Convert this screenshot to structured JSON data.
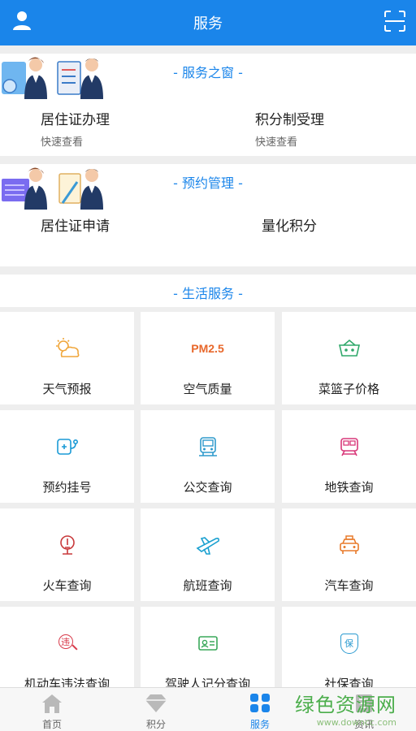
{
  "header": {
    "title": "服务"
  },
  "service_window": {
    "title": "- 服务之窗 -",
    "items": [
      {
        "name": "居住证办理",
        "sub": "快速查看"
      },
      {
        "name": "积分制受理",
        "sub": "快速查看"
      }
    ]
  },
  "appointment": {
    "title": "- 预约管理 -",
    "items": [
      {
        "name": "居住证申请"
      },
      {
        "name": "量化积分"
      }
    ]
  },
  "life": {
    "title": "- 生活服务 -",
    "items": [
      {
        "label": "天气预报",
        "icon": "weather-icon",
        "color": "#f0a63a"
      },
      {
        "label": "空气质量",
        "icon": "pm25-icon",
        "icon_text": "PM2.5",
        "color": "#e8672a"
      },
      {
        "label": "菜篮子价格",
        "icon": "basket-icon",
        "color": "#2fa86a"
      },
      {
        "label": "预约挂号",
        "icon": "stethoscope-icon",
        "color": "#1a9ad6"
      },
      {
        "label": "公交查询",
        "icon": "bus-icon",
        "color": "#2f9acc"
      },
      {
        "label": "地铁查询",
        "icon": "subway-icon",
        "color": "#d8397a"
      },
      {
        "label": "火车查询",
        "icon": "train-icon",
        "color": "#c8383a"
      },
      {
        "label": "航班查询",
        "icon": "plane-icon",
        "color": "#1aa0d0"
      },
      {
        "label": "汽车查询",
        "icon": "taxi-icon",
        "color": "#e87a2a"
      },
      {
        "label": "机动车违法查询",
        "icon": "violation-icon",
        "icon_text": "违",
        "color": "#d83a4a"
      },
      {
        "label": "驾驶人记分查询",
        "icon": "license-icon",
        "color": "#3aa85a"
      },
      {
        "label": "社保查询",
        "icon": "insurance-icon",
        "icon_text": "保",
        "color": "#2a9ad0"
      }
    ]
  },
  "tabs": [
    {
      "label": "首页",
      "icon": "home-icon"
    },
    {
      "label": "积分",
      "icon": "diamond-icon"
    },
    {
      "label": "服务",
      "icon": "grid-icon",
      "active": true
    },
    {
      "label": "资讯",
      "icon": "news-icon"
    }
  ],
  "watermark": {
    "big": "绿色资源网",
    "small": "www.downcc.com"
  },
  "colors": {
    "accent": "#1a85ea",
    "background": "#eeeeee"
  }
}
